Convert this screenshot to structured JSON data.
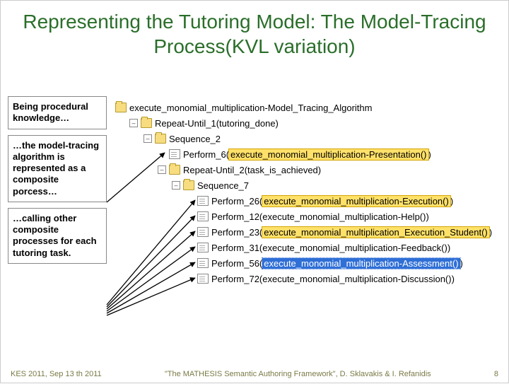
{
  "title": "Representing the Tutoring Model: The Model-Tracing Process(KVL variation)",
  "sidebar": {
    "box1": "Being procedural knowledge…",
    "box2": "…the model-tracing algorithm is represented as a composite porcess…",
    "box3": "…calling other composite processes for each tutoring task."
  },
  "tree": {
    "n0": "execute_monomial_multiplication-Model_Tracing_Algorithm",
    "n1": "Repeat-Until_1(tutoring_done)",
    "n2": "Sequence_2",
    "n3_pre": "Perform_6(",
    "n3_hl": "execute_monomial_multiplication-Presentation()",
    "n3_post": ")",
    "n4": "Repeat-Until_2(task_is_achieved)",
    "n5": "Sequence_7",
    "n6_pre": "Perform_26(",
    "n6_hl": "execute_monomial_multiplication-Execution()",
    "n6_post": ")",
    "n7": "Perform_12(execute_monomial_multiplication-Help())",
    "n8_pre": "Perform_23(",
    "n8_hl": "execute_monomial_multiplication_Execution_Student()",
    "n8_post": ")",
    "n9": "Perform_31(execute_monomial_multiplication-Feedback())",
    "n10_pre": "Perform_56(",
    "n10_hl": "execute_monomial_multiplication-Assessment()",
    "n10_post": ")",
    "n11": "Perform_72(execute_monomial_multiplication-Discussion())"
  },
  "footer": {
    "left": "KES 2011, Sep 13 th 2011",
    "center": "\"The MATHESIS Semantic Authoring Framework\", D. Sklavakis & I. Refanidis",
    "right": "8"
  }
}
